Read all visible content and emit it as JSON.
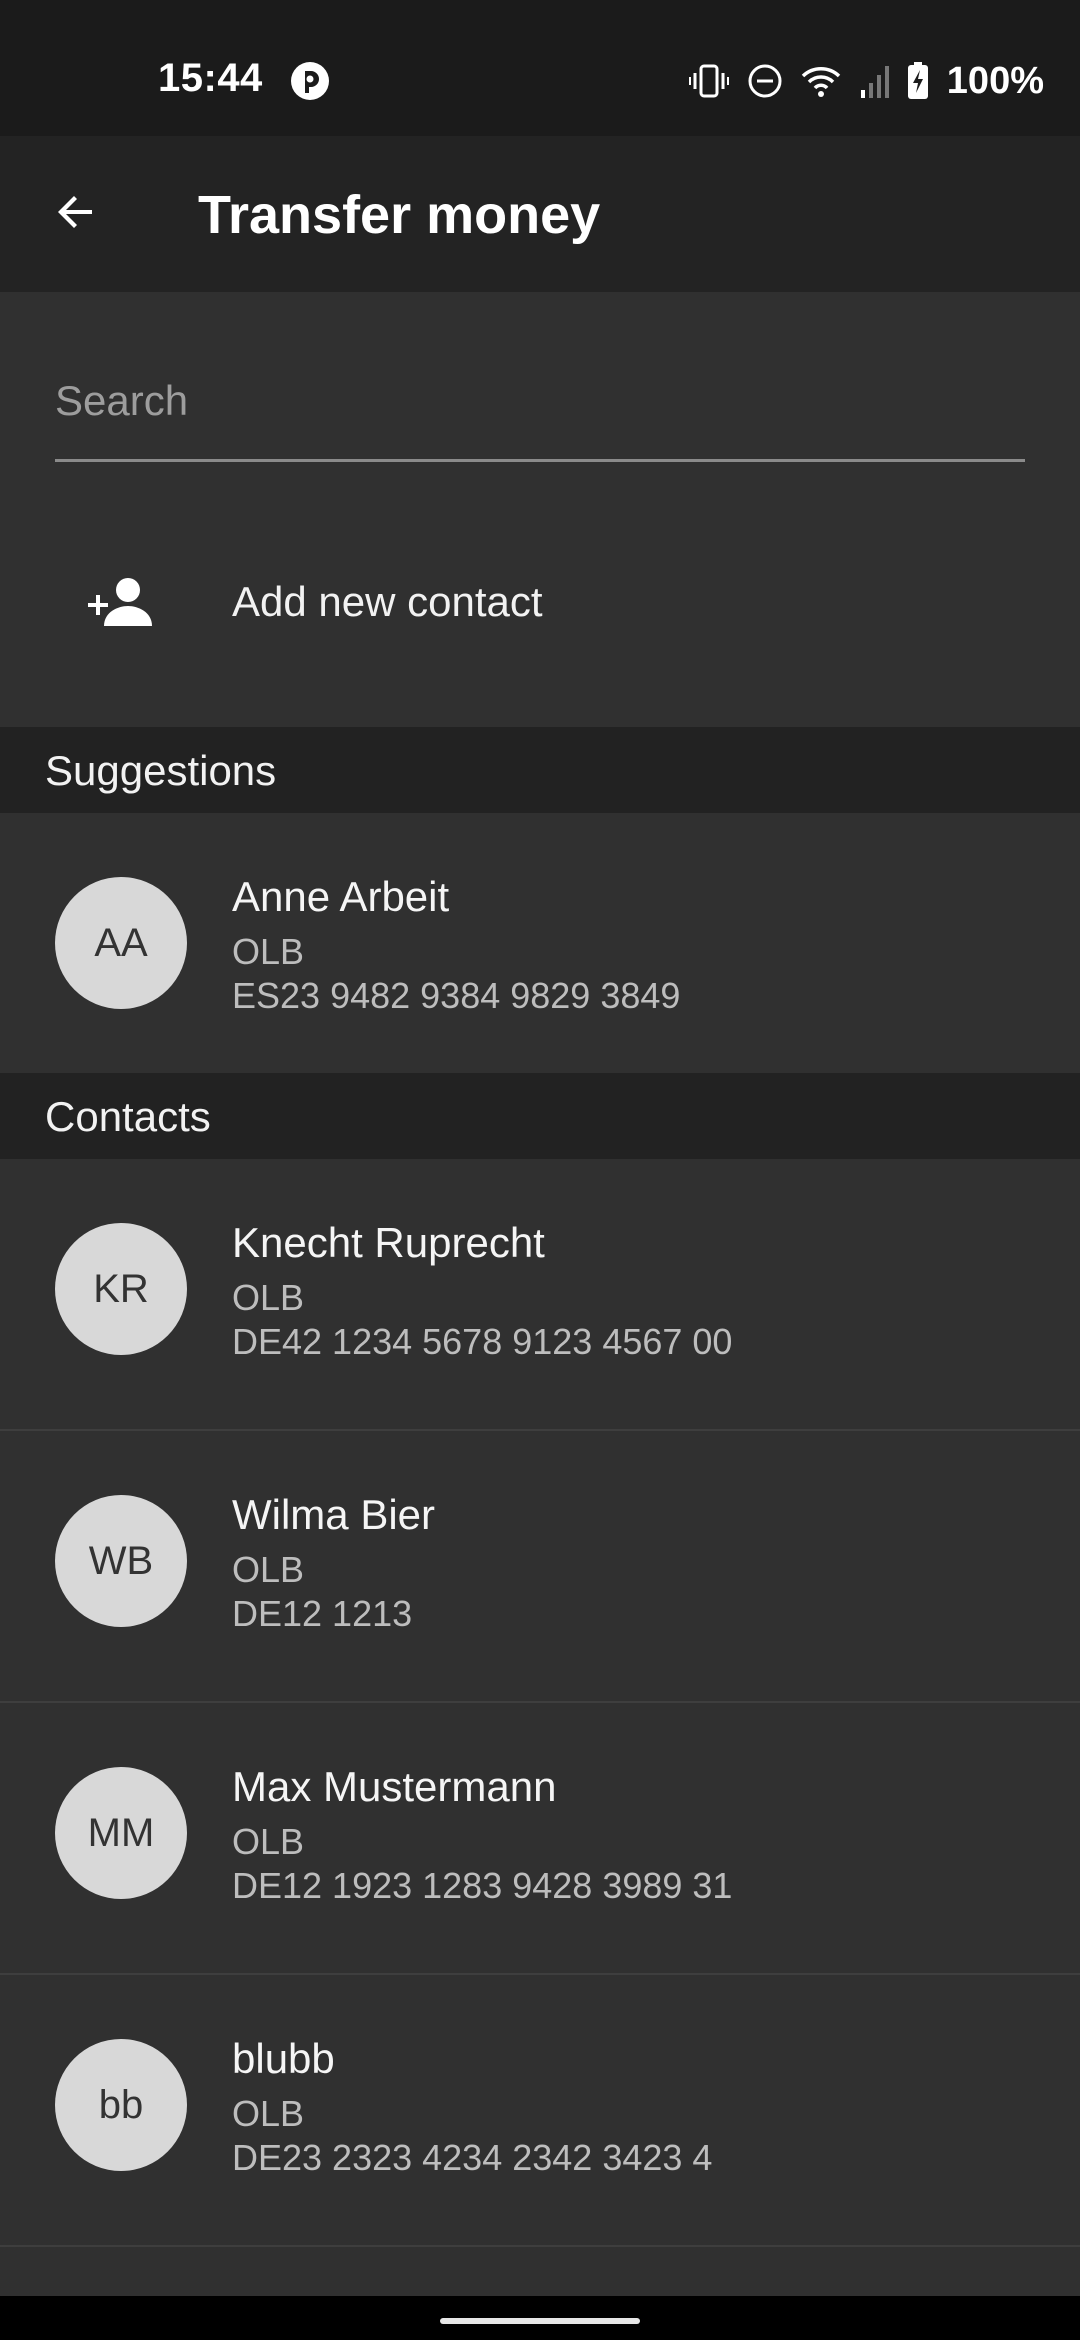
{
  "status_bar": {
    "time": "15:44",
    "battery": "100%",
    "icons": [
      "app-notification-icon",
      "vibrate-icon",
      "do-not-disturb-icon",
      "wifi-icon",
      "cellular-signal-icon",
      "battery-charging-icon"
    ]
  },
  "app_bar": {
    "title": "Transfer money",
    "back_icon": "arrow-back-icon"
  },
  "search": {
    "placeholder": "Search",
    "value": ""
  },
  "add_contact": {
    "label": "Add new contact",
    "icon": "person-add-icon"
  },
  "suggestions": {
    "header": "Suggestions",
    "items": [
      {
        "initials": "AA",
        "name": "Anne Arbeit",
        "bank": "OLB",
        "iban": "ES23 9482 9384 9829 3849"
      }
    ]
  },
  "contacts": {
    "header": "Contacts",
    "items": [
      {
        "initials": "KR",
        "name": "Knecht Ruprecht",
        "bank": "OLB",
        "iban": "DE42 1234 5678 9123 4567 00"
      },
      {
        "initials": "WB",
        "name": "Wilma Bier",
        "bank": "OLB",
        "iban": "DE12 1213"
      },
      {
        "initials": "MM",
        "name": "Max Mustermann",
        "bank": "OLB",
        "iban": "DE12 1923 1283 9428 3989 31"
      },
      {
        "initials": "bb",
        "name": "blubb",
        "bank": "OLB",
        "iban": "DE23 2323 4234 2342 3423 4"
      }
    ]
  },
  "colors": {
    "background": "#303030",
    "app_bar": "#232323",
    "status_bar": "#1b1b1b",
    "section_header": "#222222",
    "avatar": "#d8d8d8"
  }
}
